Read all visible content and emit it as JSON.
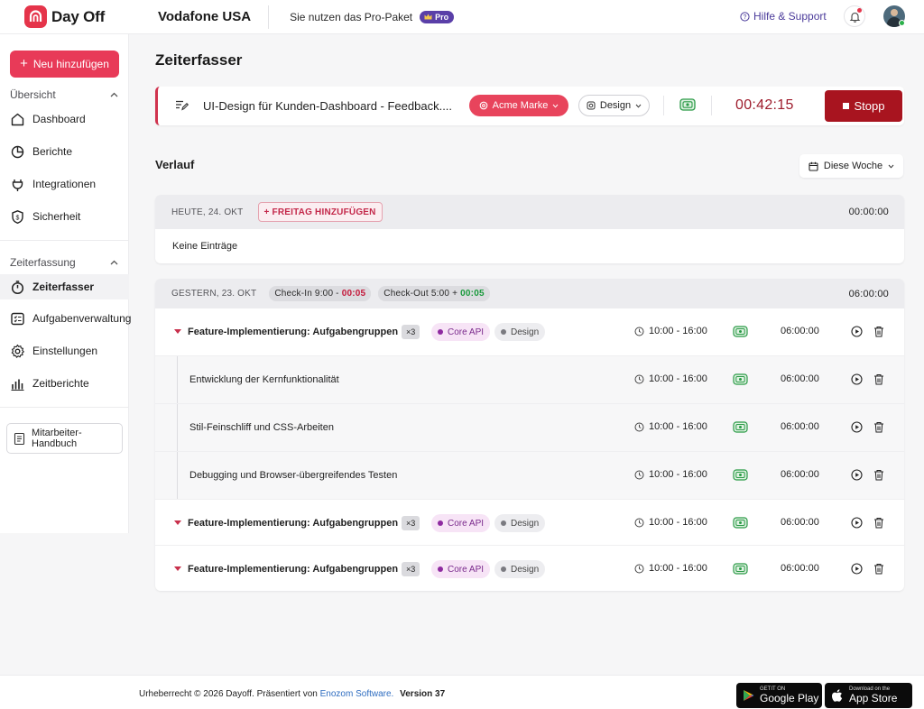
{
  "app": {
    "name": "Day Off",
    "org": "Vodafone USA",
    "plan_text": "Sie nutzen das Pro-Paket",
    "plan_badge": "Pro",
    "help": "Hilfe & Support",
    "accent": "#e83a58"
  },
  "sidebar": {
    "add_button": "Neu hinzufügen",
    "section_overview": "Übersicht",
    "overview_items": [
      {
        "label": "Dashboard",
        "icon": "home-icon"
      },
      {
        "label": "Berichte",
        "icon": "pie-chart-icon"
      },
      {
        "label": "Integrationen",
        "icon": "plug-icon"
      },
      {
        "label": "Sicherheit",
        "icon": "shield-icon"
      }
    ],
    "section_time": "Zeiterfassung",
    "time_items": [
      {
        "label": "Zeiterfasser",
        "icon": "stopwatch-icon",
        "active": true
      },
      {
        "label": "Aufgabenverwaltung",
        "icon": "tasks-icon"
      },
      {
        "label": "Einstellungen",
        "icon": "gear-icon"
      },
      {
        "label": "Zeitberichte",
        "icon": "bar-chart-icon"
      }
    ],
    "handbook_line1": "Mitarbeiter-",
    "handbook_line2": "Handbuch"
  },
  "main": {
    "title": "Zeiterfasser",
    "timer": {
      "description": "UI-Design für Kunden-Dashboard - Feedback....",
      "client": "Acme Marke",
      "project": "Design",
      "elapsed": "00:42:15",
      "stop_label": "Stopp"
    },
    "history_title": "Verlauf",
    "range_select": "Diese Woche",
    "today": {
      "label": "HEUTE, 24. OKT",
      "add_button": "+ FREITAG HINZUFÜGEN",
      "total": "00:00:00",
      "empty_text": "Keine Einträge"
    },
    "yesterday": {
      "label": "GESTERN, 23. OKT",
      "checkin_label": "Check-In 9:00 -",
      "checkin_delta": "00:05",
      "checkout_label": "Check-Out 5:00 +",
      "checkout_delta": "00:05",
      "total": "06:00:00",
      "entries": [
        {
          "title": "Feature-Implementierung: Aufgabengruppen",
          "count": "×3",
          "tag1": "Core API",
          "tag2": "Design",
          "range": "10:00 - 16:00",
          "duration": "06:00:00"
        },
        {
          "title": "Entwicklung der Kernfunktionalität",
          "range": "10:00 - 16:00",
          "duration": "06:00:00"
        },
        {
          "title": "Stil-Feinschliff und CSS-Arbeiten",
          "range": "10:00 - 16:00",
          "duration": "06:00:00"
        },
        {
          "title": "Debugging und Browser-übergreifendes Testen",
          "range": "10:00 - 16:00",
          "duration": "06:00:00"
        },
        {
          "title": "Feature-Implementierung: Aufgabengruppen",
          "count": "×3",
          "tag1": "Core API",
          "tag2": "Design",
          "range": "10:00 - 16:00",
          "duration": "06:00:00"
        },
        {
          "title": "Feature-Implementierung: Aufgabengruppen",
          "count": "×3",
          "tag1": "Core API",
          "tag2": "Design",
          "range": "10:00 - 16:00",
          "duration": "06:00:00"
        }
      ]
    }
  },
  "footer": {
    "copyright": "Urheberrecht © 2026 Dayoff. Präsentiert von",
    "company": "Enozom Software.",
    "version": "Version 37",
    "google_small": "GETIT ON",
    "google_big": "Google Play",
    "apple_small": "Download on the",
    "apple_big": "App Store"
  }
}
